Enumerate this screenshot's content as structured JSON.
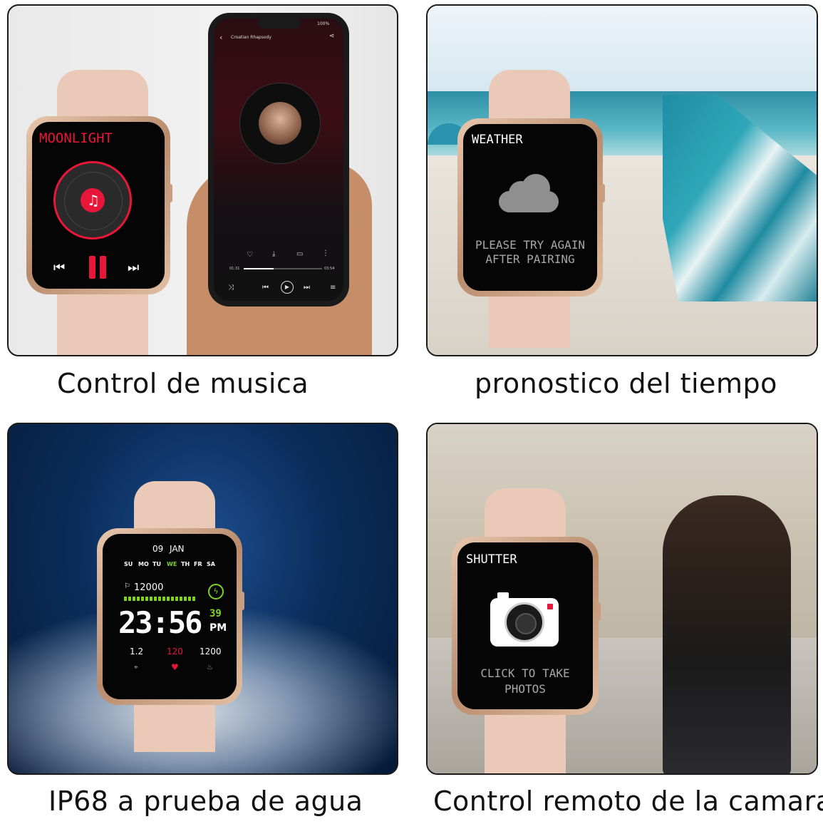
{
  "captions": {
    "music": "Control de musica",
    "weather": "pronostico del tiempo",
    "waterproof": "IP68 a prueba de agua",
    "camera": "Control remoto de la camara"
  },
  "music_watch": {
    "title": "MOONLIGHT"
  },
  "music_phone": {
    "song": "Croatian Rhapsody",
    "time_elapsed": "01:31",
    "time_total": "03:54",
    "battery": "100%"
  },
  "weather_watch": {
    "title": "WEATHER",
    "message_line1": "PLEASE TRY AGAIN",
    "message_line2": "AFTER PAIRING"
  },
  "water_watch": {
    "day": "09",
    "month": "JAN",
    "weekdays": [
      "SU",
      "MO",
      "TU",
      "WE",
      "TH",
      "FR",
      "SA"
    ],
    "active_weekday": "WE",
    "steps": "12000",
    "time": "23:56",
    "seconds": "39",
    "ampm": "PM",
    "stat_left": "1.2",
    "stat_mid": "120",
    "stat_right": "1200"
  },
  "camera_watch": {
    "title": "SHUTTER",
    "message_line1": "CLICK TO TAKE",
    "message_line2": "PHOTOS"
  },
  "colors": {
    "watch_band": "#eac9b8",
    "accent_red": "#e8173a",
    "shutter_white": "#ffffff"
  }
}
